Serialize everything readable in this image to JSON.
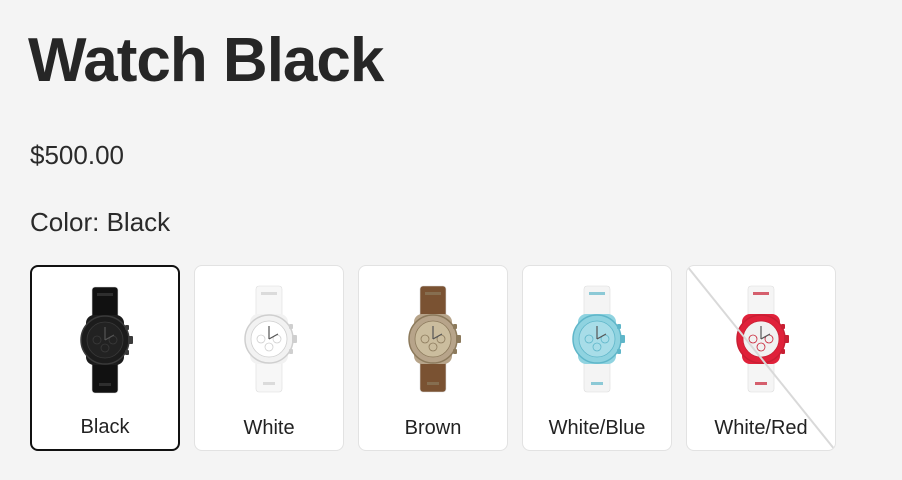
{
  "product": {
    "title": "Watch Black",
    "price": "$500.00"
  },
  "color": {
    "label": "Color:",
    "selected": "Black"
  },
  "swatches": [
    {
      "name": "Black",
      "selected": true,
      "available": true,
      "case": "#1c1c1c",
      "strap": "#111111",
      "dial": "#222222",
      "accent": "#3a3a3a"
    },
    {
      "name": "White",
      "selected": false,
      "available": true,
      "case": "#f2f2f2",
      "strap": "#f7f7f7",
      "dial": "#ffffff",
      "accent": "#cfcfcf"
    },
    {
      "name": "Brown",
      "selected": false,
      "available": true,
      "case": "#b7a48a",
      "strap": "#7a5232",
      "dial": "#cbbd9e",
      "accent": "#8c7a5c"
    },
    {
      "name": "White/Blue",
      "selected": false,
      "available": true,
      "case": "#8fd3e0",
      "strap": "#f4f4f4",
      "dial": "#a8dde8",
      "accent": "#5fb6c9"
    },
    {
      "name": "White/Red",
      "selected": false,
      "available": false,
      "case": "#e0213a",
      "strap": "#f5f5f5",
      "dial": "#f1f1f1",
      "accent": "#c81f33"
    }
  ]
}
